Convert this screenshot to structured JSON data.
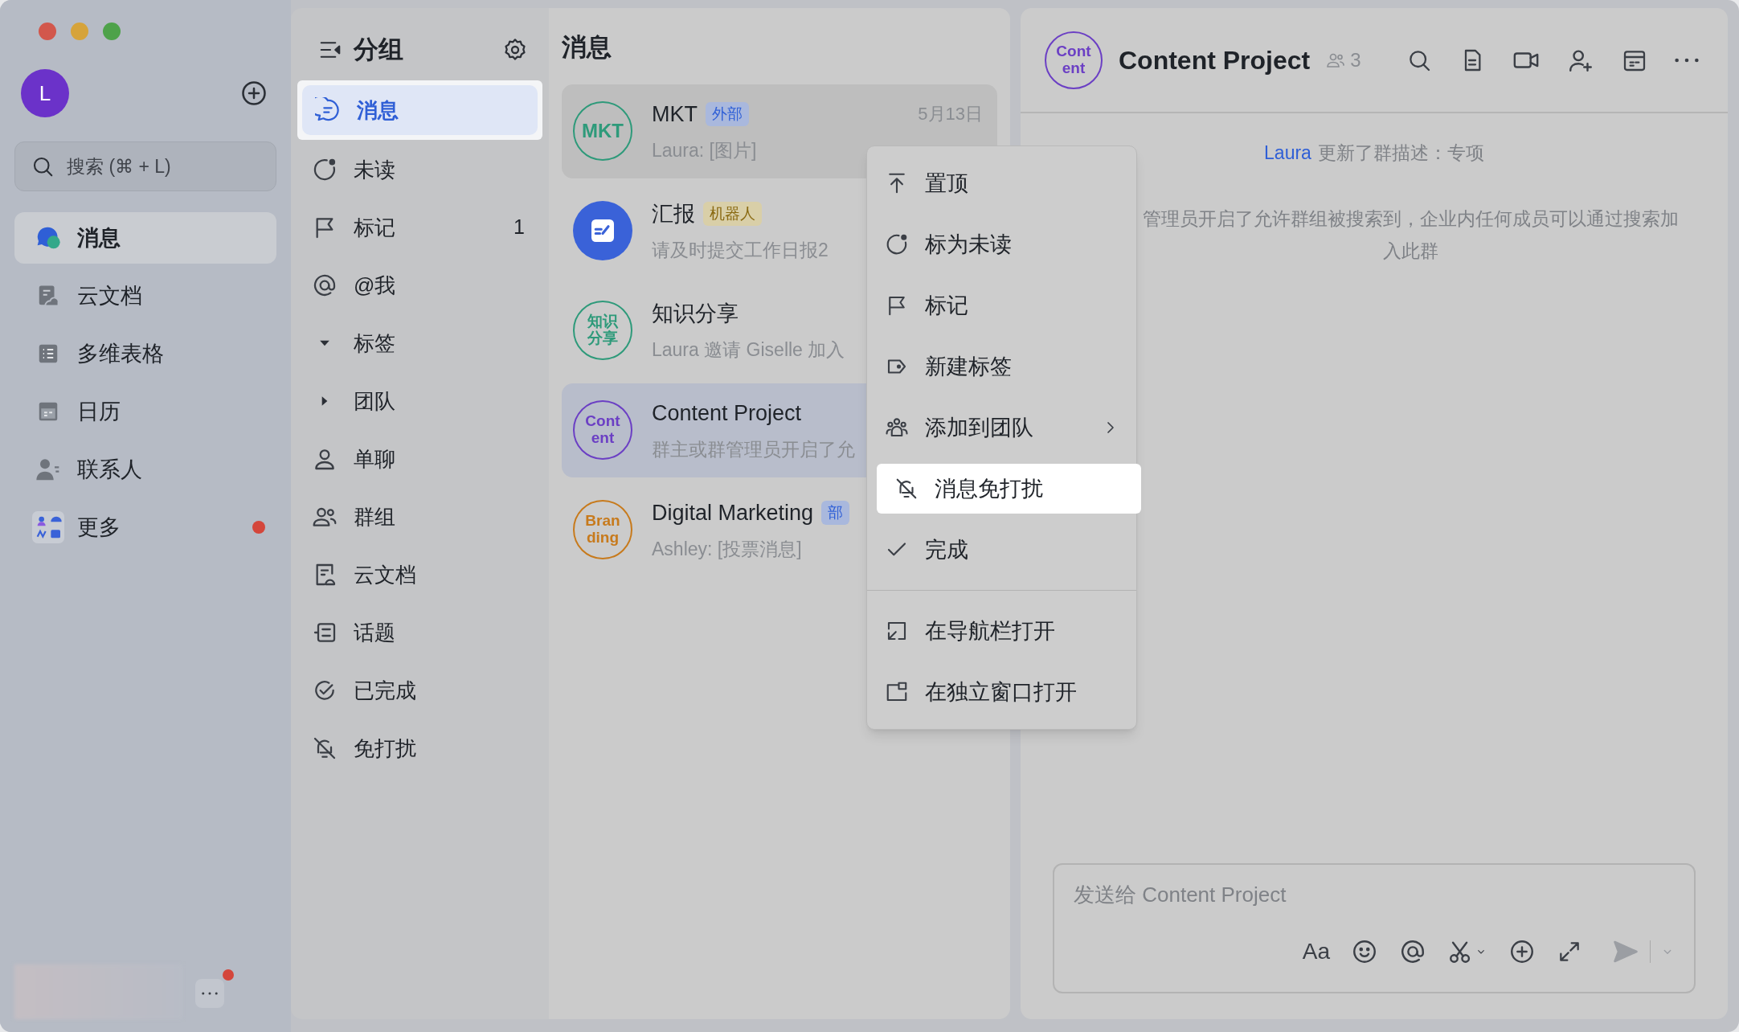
{
  "sidebar": {
    "avatar_text": "L",
    "search": {
      "placeholder": "搜索 (⌘ + L)"
    },
    "items": [
      {
        "label": "消息",
        "selected": true,
        "badge": false
      },
      {
        "label": "云文档",
        "selected": false,
        "badge": false
      },
      {
        "label": "多维表格",
        "selected": false,
        "badge": false
      },
      {
        "label": "日历",
        "selected": false,
        "badge": false
      },
      {
        "label": "联系人",
        "selected": false,
        "badge": false
      },
      {
        "label": "更多",
        "selected": false,
        "badge": true
      }
    ],
    "footer": {
      "more_badge": true
    }
  },
  "groups": {
    "title": "分组",
    "items": [
      {
        "kind": "item",
        "label": "消息",
        "selected": true
      },
      {
        "kind": "item",
        "label": "未读",
        "selected": false
      },
      {
        "kind": "item",
        "label": "标记",
        "count": "1",
        "selected": false
      },
      {
        "kind": "item",
        "label": "@我",
        "selected": false
      },
      {
        "kind": "folder",
        "label": "标签",
        "expanded": true,
        "selected": false
      },
      {
        "kind": "folder",
        "label": "团队",
        "expanded": false,
        "selected": false
      },
      {
        "kind": "item",
        "label": "单聊",
        "selected": false
      },
      {
        "kind": "item",
        "label": "群组",
        "selected": false
      },
      {
        "kind": "item",
        "label": "云文档",
        "selected": false
      },
      {
        "kind": "item",
        "label": "话题",
        "selected": false
      },
      {
        "kind": "item",
        "label": "已完成",
        "selected": false
      },
      {
        "kind": "item",
        "label": "免打扰",
        "selected": false
      }
    ]
  },
  "messages": {
    "title": "消息",
    "chats": [
      {
        "kind": "text",
        "avatar": [
          "MKT"
        ],
        "color": "#2e9a7a",
        "name": "MKT",
        "tag": {
          "label": "外部",
          "kind": "blue"
        },
        "time": "5月13日",
        "preview": "Laura: [图片]",
        "selected": false,
        "hovered": true
      },
      {
        "kind": "bot",
        "color": "#3a62d8",
        "name": "汇报",
        "tag": {
          "label": "机器人",
          "kind": "yellow"
        },
        "preview": "请及时提交工作日报2",
        "selected": false,
        "hovered": false
      },
      {
        "kind": "text",
        "avatar": [
          "知识",
          "分享"
        ],
        "color": "#2e9a7a",
        "name": "知识分享",
        "preview": "Laura 邀请 Giselle 加入",
        "selected": false,
        "hovered": false
      },
      {
        "kind": "text",
        "avatar": [
          "Cont",
          "ent"
        ],
        "color": "#6b3fc4",
        "name": "Content Project",
        "preview": "群主或群管理员开启了允",
        "selected": true,
        "hovered": false
      },
      {
        "kind": "text",
        "avatar": [
          "Bran",
          "ding"
        ],
        "color": "#c77a1c",
        "name": "Digital Marketing",
        "tag": {
          "label": "部",
          "kind": "blue"
        },
        "preview": "Ashley: [投票消息]",
        "selected": false,
        "hovered": false
      }
    ]
  },
  "menu": {
    "sections": [
      [
        {
          "label": "置顶",
          "highlighted": false,
          "submenu": false
        },
        {
          "label": "标为未读",
          "highlighted": false,
          "submenu": false
        },
        {
          "label": "标记",
          "highlighted": false,
          "submenu": false
        },
        {
          "label": "新建标签",
          "highlighted": false,
          "submenu": false
        },
        {
          "label": "添加到团队",
          "highlighted": false,
          "submenu": true
        },
        {
          "label": "消息免打扰",
          "highlighted": true,
          "submenu": false
        },
        {
          "label": "完成",
          "highlighted": false,
          "submenu": false
        }
      ],
      [
        {
          "label": "在导航栏打开",
          "highlighted": false,
          "submenu": false
        },
        {
          "label": "在独立窗口打开",
          "highlighted": false,
          "submenu": false
        }
      ]
    ]
  },
  "chat": {
    "avatar": [
      "Cont",
      "ent"
    ],
    "title": "Content Project",
    "members": "3",
    "system_messages": [
      {
        "sender": "Laura",
        "text": "更新了群描述：专项"
      },
      {
        "text": "管理员开启了允许群组被搜索到，企业内任何成员可以通过搜索加入此群"
      }
    ],
    "input": {
      "placeholder": "发送给 Content Project",
      "format_label": "Aa"
    }
  }
}
